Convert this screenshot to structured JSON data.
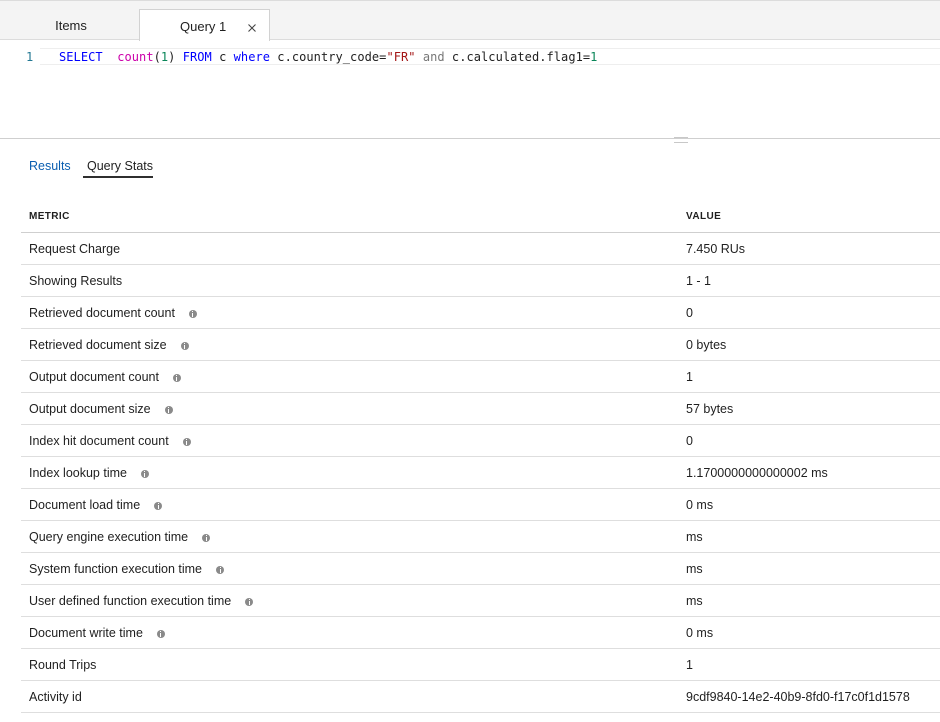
{
  "tabs": {
    "items_label": "Items",
    "query_label": "Query 1"
  },
  "editor": {
    "line_number": "1",
    "tokens": [
      {
        "t": "SELECT",
        "c": "kw"
      },
      {
        "t": "  ",
        "c": "pl"
      },
      {
        "t": "count",
        "c": "fn"
      },
      {
        "t": "(",
        "c": "pl"
      },
      {
        "t": "1",
        "c": "num"
      },
      {
        "t": ") ",
        "c": "pl"
      },
      {
        "t": "FROM",
        "c": "kw"
      },
      {
        "t": " c ",
        "c": "pl"
      },
      {
        "t": "where",
        "c": "kw"
      },
      {
        "t": " c.country_code=",
        "c": "pl"
      },
      {
        "t": "\"FR\"",
        "c": "str"
      },
      {
        "t": " ",
        "c": "pl"
      },
      {
        "t": "and",
        "c": "op"
      },
      {
        "t": " c.calculated.flag1=",
        "c": "pl"
      },
      {
        "t": "1",
        "c": "num"
      }
    ]
  },
  "result_tabs": {
    "results_label": "Results",
    "stats_label": "Query Stats"
  },
  "stats": {
    "metric_header": "METRIC",
    "value_header": "VALUE",
    "rows": [
      {
        "metric": "Request Charge",
        "info": false,
        "value": "7.450 RUs"
      },
      {
        "metric": "Showing Results",
        "info": false,
        "value": "1 - 1"
      },
      {
        "metric": "Retrieved document count",
        "info": true,
        "value": "0"
      },
      {
        "metric": "Retrieved document size",
        "info": true,
        "value": "0 bytes"
      },
      {
        "metric": "Output document count",
        "info": true,
        "value": "1"
      },
      {
        "metric": "Output document size",
        "info": true,
        "value": "57 bytes"
      },
      {
        "metric": "Index hit document count",
        "info": true,
        "value": "0"
      },
      {
        "metric": "Index lookup time",
        "info": true,
        "value": "1.1700000000000002 ms"
      },
      {
        "metric": "Document load time",
        "info": true,
        "value": "0 ms"
      },
      {
        "metric": "Query engine execution time",
        "info": true,
        "value": "ms"
      },
      {
        "metric": "System function execution time",
        "info": true,
        "value": "ms"
      },
      {
        "metric": "User defined function execution time",
        "info": true,
        "value": "ms"
      },
      {
        "metric": "Document write time",
        "info": true,
        "value": "0 ms"
      },
      {
        "metric": "Round Trips",
        "info": false,
        "value": "1"
      },
      {
        "metric": "Activity id",
        "info": false,
        "value": "9cdf9840-14e2-40b9-8fd0-f17c0f1d1578"
      }
    ]
  }
}
